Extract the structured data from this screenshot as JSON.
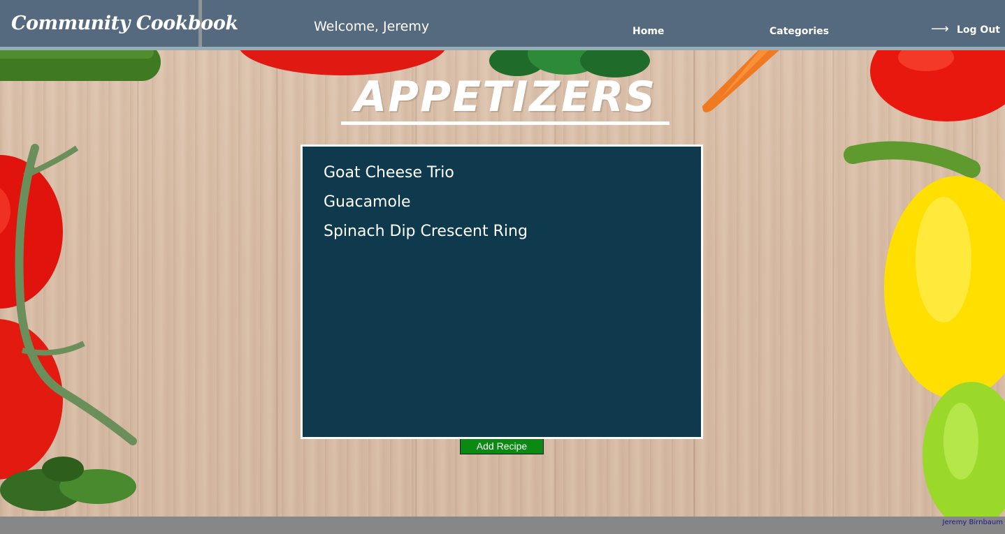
{
  "header": {
    "brand": "Community Cookbook",
    "welcome": "Welcome, Jeremy",
    "nav": {
      "home": "Home",
      "categories": "Categories",
      "logout": "Log Out",
      "logout_icon": "⟶"
    }
  },
  "category": {
    "title": "APPETIZERS"
  },
  "recipes": [
    "Goat Cheese Trio",
    "Guacamole",
    "Spinach Dip Crescent Ring"
  ],
  "add_recipe_label": "Add Recipe",
  "footer": {
    "credit": "Jeremy Birnbaum"
  },
  "colors": {
    "header_bg": "#556a7e",
    "panel_bg": "#0f3a4e",
    "add_button": "#0a8a12",
    "footer_bg": "#878787"
  }
}
